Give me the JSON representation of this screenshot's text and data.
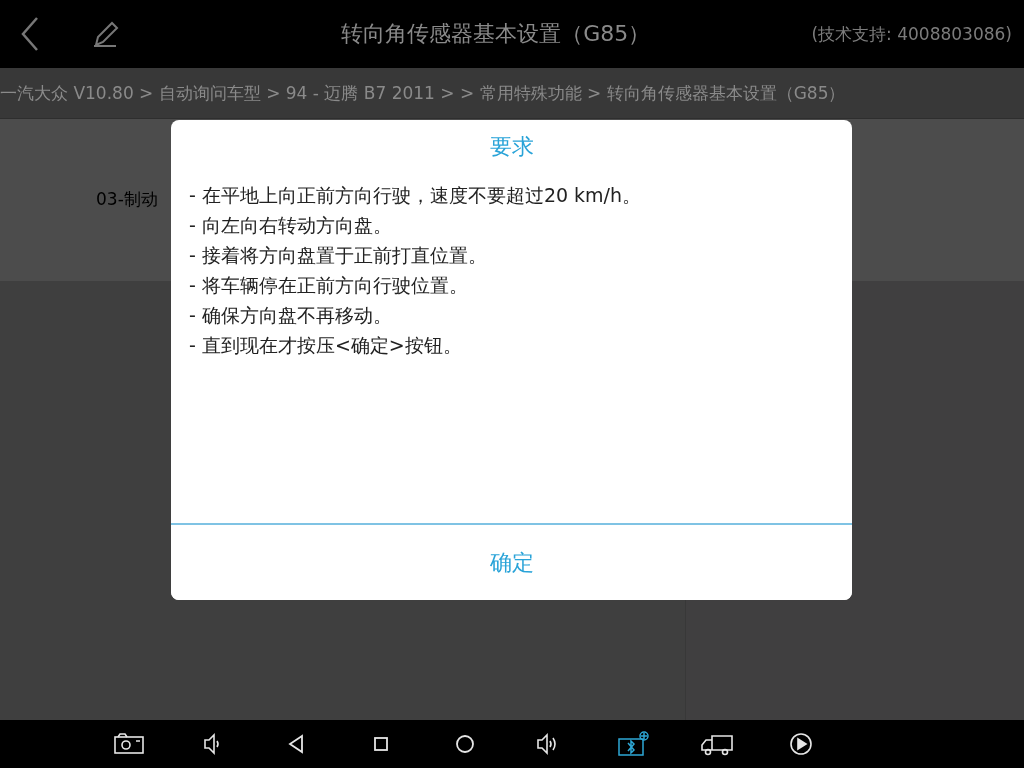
{
  "header": {
    "title": "转向角传感器基本设置（G85）",
    "support": "(技术支持: 4008803086)"
  },
  "breadcrumb": "一汽大众 V10.80 > 自动询问车型 > 94 - 迈腾 B7 2011 > > 常用特殊功能 > 转向角传感器基本设置（G85）",
  "background_item": "03-制动",
  "dialog": {
    "title": "要求",
    "lines": [
      "- 在平地上向正前方向行驶，速度不要超过20 km/h。",
      "- 向左向右转动方向盘。",
      "- 接着将方向盘置于正前打直位置。",
      "- 将车辆停在正前方向行驶位置。",
      "- 确保方向盘不再移动。",
      "- 直到现在才按压<确定>按钮。"
    ],
    "button": "确定"
  },
  "nav_buttons": [
    {
      "kind": "camera",
      "active": false
    },
    {
      "kind": "volume_down",
      "active": false
    },
    {
      "kind": "back",
      "active": false
    },
    {
      "kind": "recents",
      "active": false
    },
    {
      "kind": "home",
      "active": false
    },
    {
      "kind": "volume_up",
      "active": false
    },
    {
      "kind": "bluetooth",
      "active": true
    },
    {
      "kind": "truck",
      "active": false
    },
    {
      "kind": "play",
      "active": false
    }
  ]
}
